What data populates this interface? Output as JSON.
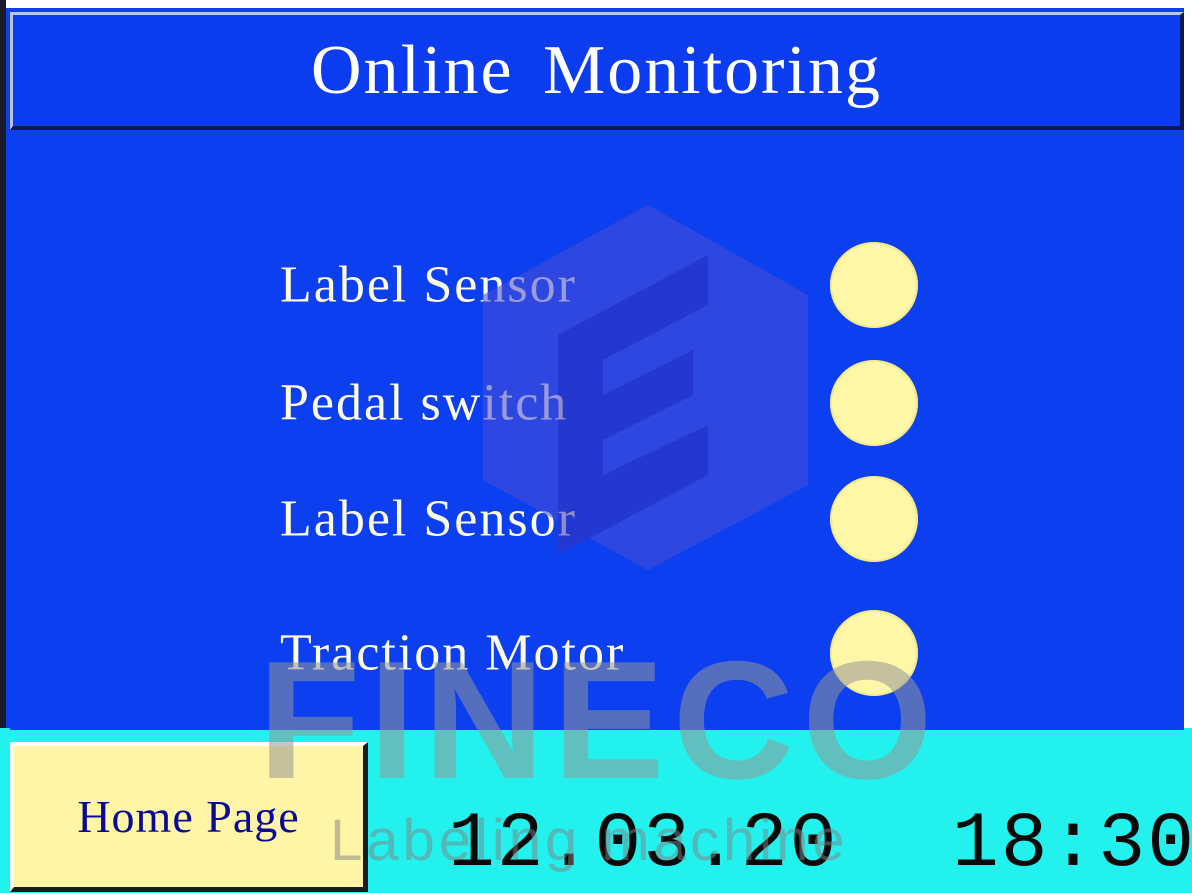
{
  "screen": {
    "title": "Online Monitoring",
    "colors": {
      "background": "#0b3ff0",
      "title_text": "#ffffff",
      "label_text": "#fdfbe6",
      "indicator_off": "#fff7a8",
      "footer_background": "#22f1ee",
      "button_background": "#fff5a6",
      "button_text": "#0a0a9a"
    }
  },
  "monitors": [
    {
      "label": "Label Sensor",
      "indicator": "lamp-icon"
    },
    {
      "label": "Pedal switch",
      "indicator": "lamp-icon"
    },
    {
      "label": "Label Sensor",
      "indicator": "lamp-icon"
    },
    {
      "label": "Traction Motor",
      "indicator": "lamp-icon"
    }
  ],
  "footer": {
    "home_button_label": "Home Page",
    "date": "12.03.20",
    "time": "18:30"
  },
  "watermark": {
    "brand": "FINECO",
    "tagline": "Labeling machine",
    "logo_icon": "fineco-e-logo-icon"
  }
}
